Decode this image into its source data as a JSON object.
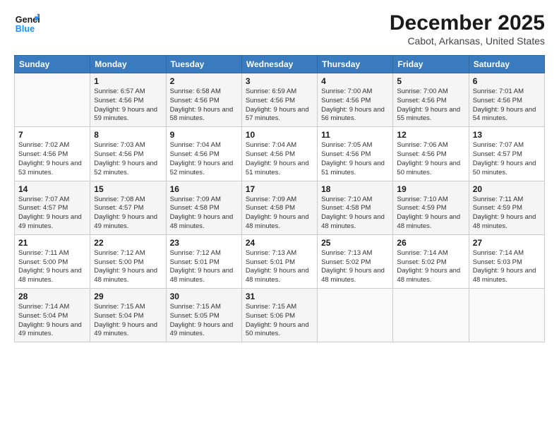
{
  "header": {
    "logo_line1": "General",
    "logo_line2": "Blue",
    "title": "December 2025",
    "subtitle": "Cabot, Arkansas, United States"
  },
  "weekdays": [
    "Sunday",
    "Monday",
    "Tuesday",
    "Wednesday",
    "Thursday",
    "Friday",
    "Saturday"
  ],
  "weeks": [
    [
      {
        "num": "",
        "sunrise": "",
        "sunset": "",
        "daylight": ""
      },
      {
        "num": "1",
        "sunrise": "Sunrise: 6:57 AM",
        "sunset": "Sunset: 4:56 PM",
        "daylight": "Daylight: 9 hours and 59 minutes."
      },
      {
        "num": "2",
        "sunrise": "Sunrise: 6:58 AM",
        "sunset": "Sunset: 4:56 PM",
        "daylight": "Daylight: 9 hours and 58 minutes."
      },
      {
        "num": "3",
        "sunrise": "Sunrise: 6:59 AM",
        "sunset": "Sunset: 4:56 PM",
        "daylight": "Daylight: 9 hours and 57 minutes."
      },
      {
        "num": "4",
        "sunrise": "Sunrise: 7:00 AM",
        "sunset": "Sunset: 4:56 PM",
        "daylight": "Daylight: 9 hours and 56 minutes."
      },
      {
        "num": "5",
        "sunrise": "Sunrise: 7:00 AM",
        "sunset": "Sunset: 4:56 PM",
        "daylight": "Daylight: 9 hours and 55 minutes."
      },
      {
        "num": "6",
        "sunrise": "Sunrise: 7:01 AM",
        "sunset": "Sunset: 4:56 PM",
        "daylight": "Daylight: 9 hours and 54 minutes."
      }
    ],
    [
      {
        "num": "7",
        "sunrise": "Sunrise: 7:02 AM",
        "sunset": "Sunset: 4:56 PM",
        "daylight": "Daylight: 9 hours and 53 minutes."
      },
      {
        "num": "8",
        "sunrise": "Sunrise: 7:03 AM",
        "sunset": "Sunset: 4:56 PM",
        "daylight": "Daylight: 9 hours and 52 minutes."
      },
      {
        "num": "9",
        "sunrise": "Sunrise: 7:04 AM",
        "sunset": "Sunset: 4:56 PM",
        "daylight": "Daylight: 9 hours and 52 minutes."
      },
      {
        "num": "10",
        "sunrise": "Sunrise: 7:04 AM",
        "sunset": "Sunset: 4:56 PM",
        "daylight": "Daylight: 9 hours and 51 minutes."
      },
      {
        "num": "11",
        "sunrise": "Sunrise: 7:05 AM",
        "sunset": "Sunset: 4:56 PM",
        "daylight": "Daylight: 9 hours and 51 minutes."
      },
      {
        "num": "12",
        "sunrise": "Sunrise: 7:06 AM",
        "sunset": "Sunset: 4:56 PM",
        "daylight": "Daylight: 9 hours and 50 minutes."
      },
      {
        "num": "13",
        "sunrise": "Sunrise: 7:07 AM",
        "sunset": "Sunset: 4:57 PM",
        "daylight": "Daylight: 9 hours and 50 minutes."
      }
    ],
    [
      {
        "num": "14",
        "sunrise": "Sunrise: 7:07 AM",
        "sunset": "Sunset: 4:57 PM",
        "daylight": "Daylight: 9 hours and 49 minutes."
      },
      {
        "num": "15",
        "sunrise": "Sunrise: 7:08 AM",
        "sunset": "Sunset: 4:57 PM",
        "daylight": "Daylight: 9 hours and 49 minutes."
      },
      {
        "num": "16",
        "sunrise": "Sunrise: 7:09 AM",
        "sunset": "Sunset: 4:58 PM",
        "daylight": "Daylight: 9 hours and 48 minutes."
      },
      {
        "num": "17",
        "sunrise": "Sunrise: 7:09 AM",
        "sunset": "Sunset: 4:58 PM",
        "daylight": "Daylight: 9 hours and 48 minutes."
      },
      {
        "num": "18",
        "sunrise": "Sunrise: 7:10 AM",
        "sunset": "Sunset: 4:58 PM",
        "daylight": "Daylight: 9 hours and 48 minutes."
      },
      {
        "num": "19",
        "sunrise": "Sunrise: 7:10 AM",
        "sunset": "Sunset: 4:59 PM",
        "daylight": "Daylight: 9 hours and 48 minutes."
      },
      {
        "num": "20",
        "sunrise": "Sunrise: 7:11 AM",
        "sunset": "Sunset: 4:59 PM",
        "daylight": "Daylight: 9 hours and 48 minutes."
      }
    ],
    [
      {
        "num": "21",
        "sunrise": "Sunrise: 7:11 AM",
        "sunset": "Sunset: 5:00 PM",
        "daylight": "Daylight: 9 hours and 48 minutes."
      },
      {
        "num": "22",
        "sunrise": "Sunrise: 7:12 AM",
        "sunset": "Sunset: 5:00 PM",
        "daylight": "Daylight: 9 hours and 48 minutes."
      },
      {
        "num": "23",
        "sunrise": "Sunrise: 7:12 AM",
        "sunset": "Sunset: 5:01 PM",
        "daylight": "Daylight: 9 hours and 48 minutes."
      },
      {
        "num": "24",
        "sunrise": "Sunrise: 7:13 AM",
        "sunset": "Sunset: 5:01 PM",
        "daylight": "Daylight: 9 hours and 48 minutes."
      },
      {
        "num": "25",
        "sunrise": "Sunrise: 7:13 AM",
        "sunset": "Sunset: 5:02 PM",
        "daylight": "Daylight: 9 hours and 48 minutes."
      },
      {
        "num": "26",
        "sunrise": "Sunrise: 7:14 AM",
        "sunset": "Sunset: 5:02 PM",
        "daylight": "Daylight: 9 hours and 48 minutes."
      },
      {
        "num": "27",
        "sunrise": "Sunrise: 7:14 AM",
        "sunset": "Sunset: 5:03 PM",
        "daylight": "Daylight: 9 hours and 48 minutes."
      }
    ],
    [
      {
        "num": "28",
        "sunrise": "Sunrise: 7:14 AM",
        "sunset": "Sunset: 5:04 PM",
        "daylight": "Daylight: 9 hours and 49 minutes."
      },
      {
        "num": "29",
        "sunrise": "Sunrise: 7:15 AM",
        "sunset": "Sunset: 5:04 PM",
        "daylight": "Daylight: 9 hours and 49 minutes."
      },
      {
        "num": "30",
        "sunrise": "Sunrise: 7:15 AM",
        "sunset": "Sunset: 5:05 PM",
        "daylight": "Daylight: 9 hours and 49 minutes."
      },
      {
        "num": "31",
        "sunrise": "Sunrise: 7:15 AM",
        "sunset": "Sunset: 5:06 PM",
        "daylight": "Daylight: 9 hours and 50 minutes."
      },
      {
        "num": "",
        "sunrise": "",
        "sunset": "",
        "daylight": ""
      },
      {
        "num": "",
        "sunrise": "",
        "sunset": "",
        "daylight": ""
      },
      {
        "num": "",
        "sunrise": "",
        "sunset": "",
        "daylight": ""
      }
    ]
  ]
}
